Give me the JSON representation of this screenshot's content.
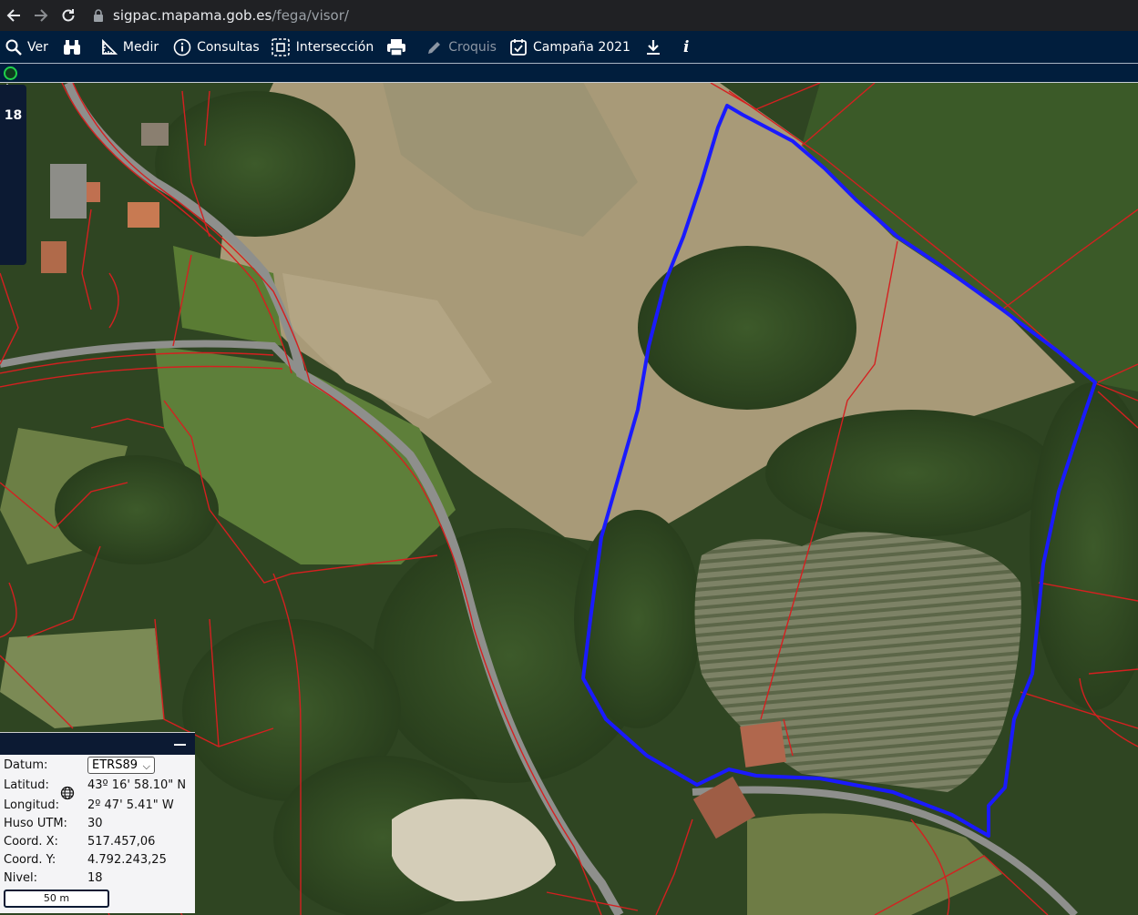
{
  "browser": {
    "url_host": "sigpac.mapama.gob.es",
    "url_path": "/fega/visor/"
  },
  "toolbar": {
    "items": [
      {
        "label": "Ver",
        "icon": "search-icon"
      },
      {
        "label": "",
        "icon": "binoculars-icon"
      },
      {
        "label": "Medir",
        "icon": "ruler-icon"
      },
      {
        "label": "Consultas",
        "icon": "info-circle-icon"
      },
      {
        "label": "Intersección",
        "icon": "intersection-icon"
      },
      {
        "label": "",
        "icon": "printer-icon"
      },
      {
        "label": "Croquis",
        "icon": "pencil-icon"
      },
      {
        "label": "Campaña 2021",
        "icon": "calendar-check-icon"
      },
      {
        "label": "",
        "icon": "download-icon"
      },
      {
        "label": "i",
        "icon": "info-italic-icon"
      }
    ]
  },
  "status": {
    "indicator_color": "#1fd04a"
  },
  "zoom_level": "18",
  "coords_panel": {
    "datum_label": "Datum:",
    "datum_value": "ETRS89",
    "lat_label": "Latitud:",
    "lat_value": "43º 16' 58.10\" N",
    "lon_label": "Longitud:",
    "lon_value": "2º 47' 5.41\" W",
    "huso_label": "Huso UTM:",
    "huso_value": "30",
    "x_label": "Coord. X:",
    "x_value": "517.457,06",
    "y_label": "Coord. Y:",
    "y_value": "4.792.243,25",
    "nivel_label": "Nivel:",
    "nivel_value": "18",
    "scale_label": "50 m"
  },
  "colors": {
    "toolbar_bg": "#011e3d",
    "parcel_lines": "#d42020",
    "selection_outline": "#1a1aff"
  }
}
